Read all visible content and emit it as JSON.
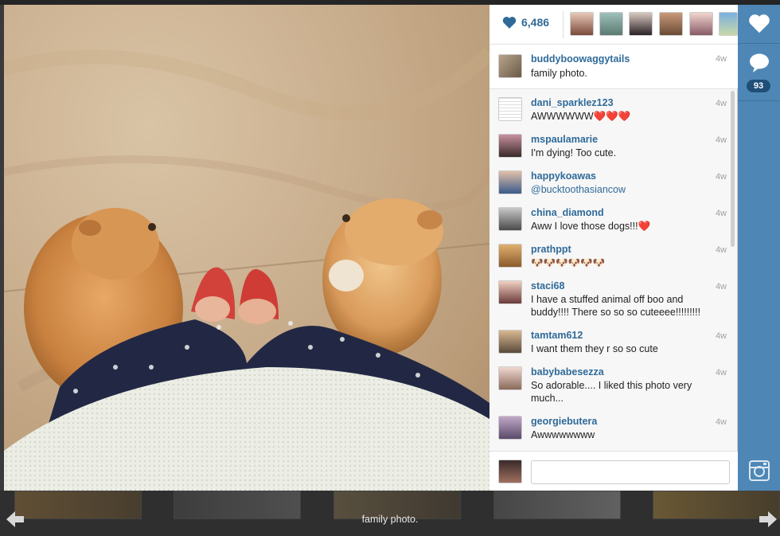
{
  "post": {
    "likes_count": "6,486",
    "author": {
      "username": "buddyboowaggytails",
      "caption": "family photo.",
      "time": "4w"
    },
    "comment_count": "93"
  },
  "comments": [
    {
      "username": "dani_sparklez123",
      "text": "AWWWWWW❤️❤️❤️",
      "time": "4w"
    },
    {
      "username": "mspaulamarie",
      "text": "I'm dying! Too cute.",
      "time": "4w"
    },
    {
      "username": "happykoawas",
      "text": "@bucktoothasiancow",
      "time": "4w"
    },
    {
      "username": "china_diamond",
      "text": "Aww I love those dogs!!!❤️",
      "time": "4w"
    },
    {
      "username": "prathppt",
      "text": "🐶🐶🐶🐶🐶🐶",
      "time": "4w"
    },
    {
      "username": "staci68",
      "text": "I have a stuffed animal off boo and buddy!!!! There so so so cuteeee!!!!!!!!!",
      "time": "4w"
    },
    {
      "username": "tamtam612",
      "text": "I want them they r so so cute",
      "time": "4w"
    },
    {
      "username": "babybabesezza",
      "text": "So adorable.... I liked this photo very much...",
      "time": "4w"
    },
    {
      "username": "georgiebutera",
      "text": "Awwwwwwww",
      "time": "4w"
    }
  ],
  "comment_input": {
    "placeholder": ""
  },
  "bottom_caption": "family photo.",
  "icons": {
    "like": "heart-icon",
    "comment": "speech-bubble-icon",
    "brand": "camera-icon",
    "prev": "arrow-left-icon",
    "next": "arrow-right-icon"
  },
  "colors": {
    "accent": "#4e87b5",
    "username": "#2f6a99",
    "badge": "#1f4f78"
  }
}
